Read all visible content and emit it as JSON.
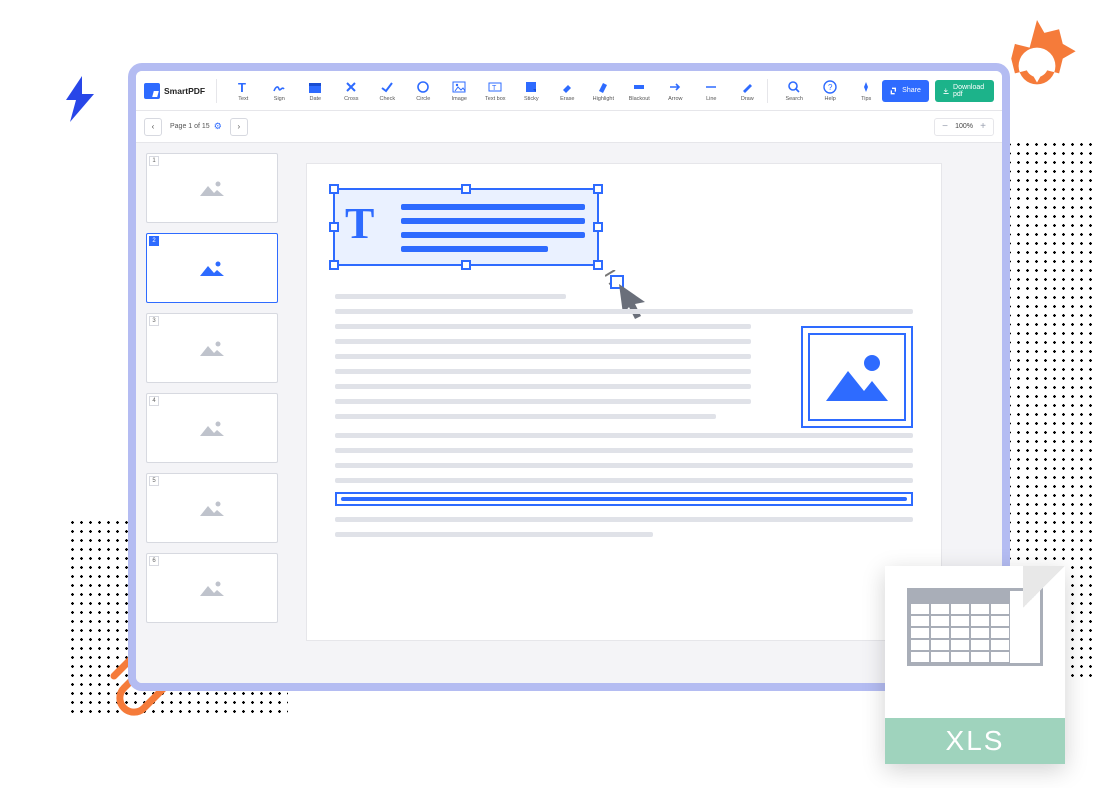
{
  "app": {
    "name": "SmartPDF"
  },
  "toolbar": {
    "tools": [
      {
        "label": "Text",
        "icon": "text-icon"
      },
      {
        "label": "Sign",
        "icon": "sign-icon"
      },
      {
        "label": "Date",
        "icon": "date-icon"
      },
      {
        "label": "Cross",
        "icon": "cross-icon"
      },
      {
        "label": "Check",
        "icon": "check-icon"
      },
      {
        "label": "Circle",
        "icon": "circle-icon"
      },
      {
        "label": "Image",
        "icon": "image-icon"
      },
      {
        "label": "Text box",
        "icon": "textbox-icon"
      },
      {
        "label": "Sticky",
        "icon": "sticky-icon"
      },
      {
        "label": "Erase",
        "icon": "erase-icon"
      },
      {
        "label": "Highlight",
        "icon": "highlight-icon"
      },
      {
        "label": "Blackout",
        "icon": "blackout-icon"
      },
      {
        "label": "Arrow",
        "icon": "arrow-icon"
      },
      {
        "label": "Line",
        "icon": "line-icon"
      },
      {
        "label": "Draw",
        "icon": "draw-icon"
      }
    ],
    "utils": [
      {
        "label": "Search",
        "icon": "search-icon"
      },
      {
        "label": "Help",
        "icon": "help-icon"
      },
      {
        "label": "Tips",
        "icon": "tips-icon"
      }
    ],
    "share_label": "Share",
    "download_label": "Download pdf"
  },
  "nav": {
    "page_info": "Page 1 of 15"
  },
  "zoom": {
    "value": "100%"
  },
  "thumbnails": [
    {
      "num": "1",
      "active": false
    },
    {
      "num": "2",
      "active": true
    },
    {
      "num": "3",
      "active": false
    },
    {
      "num": "4",
      "active": false
    },
    {
      "num": "5",
      "active": false
    },
    {
      "num": "6",
      "active": false
    }
  ],
  "textbox": {
    "glyph": "T"
  },
  "file": {
    "ext": "XLS"
  }
}
